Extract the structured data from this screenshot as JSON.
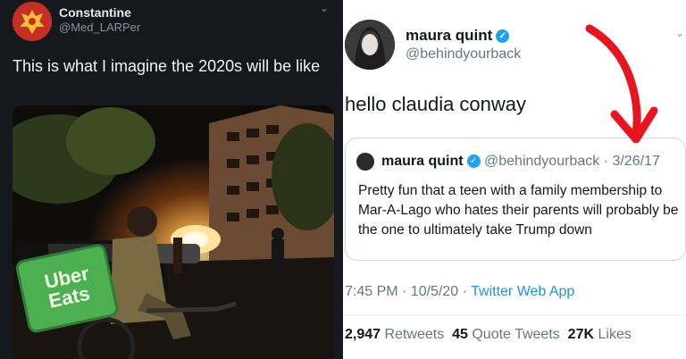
{
  "left_tweet": {
    "name": "Constantine",
    "handle": "@Med_LARPer",
    "text": "This is what I imagine the 2020s will be like",
    "bag_text_line1": "Uber",
    "bag_text_line2": "Eats"
  },
  "right_tweet": {
    "name": "maura quint",
    "handle": "@behindyourback",
    "text": "hello claudia conway",
    "quoted": {
      "name": "maura quint",
      "handle": "@behindyourback",
      "date": "· 3/26/17",
      "text": "Pretty fun that a teen with a family membership to Mar-A-Lago who hates their parents will probably be the one to ultimately take Trump down"
    },
    "time": "7:45 PM · 10/5/20 · ",
    "app": "Twitter Web App",
    "stats": {
      "retweets_count": "2,947",
      "retweets_label": "Retweets",
      "quotes_count": "45",
      "quotes_label": "Quote Tweets",
      "likes_count": "27K",
      "likes_label": "Likes"
    }
  },
  "colors": {
    "verified": "#1da1f2",
    "link": "#1b95e0",
    "arrow": "#e8141e",
    "uber_green": "#4caf50"
  },
  "icons": [
    "double-headed-eagle-avatar",
    "verified-icon",
    "chevron-down-icon",
    "red-arrow-annotation"
  ]
}
